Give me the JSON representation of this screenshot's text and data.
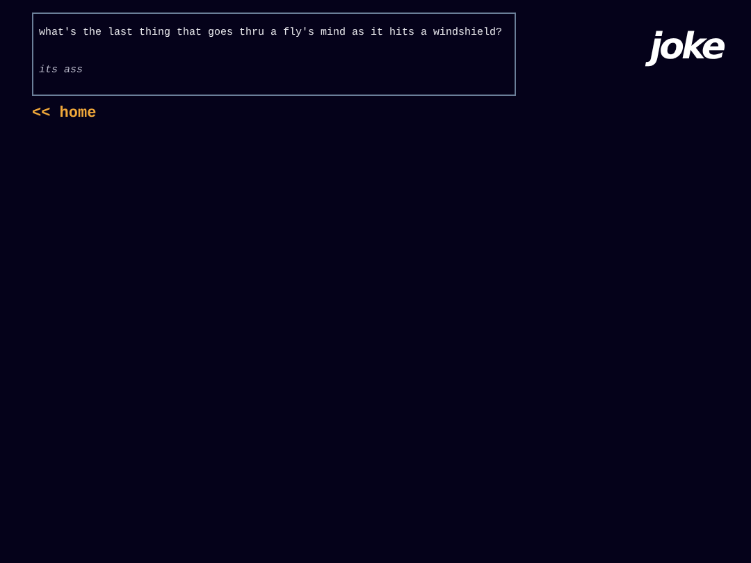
{
  "joke": {
    "question": "what's the last thing that goes thru a fly's mind as it hits a windshield?",
    "answer": "its ass"
  },
  "home_link": "<< home",
  "logo": "joke"
}
